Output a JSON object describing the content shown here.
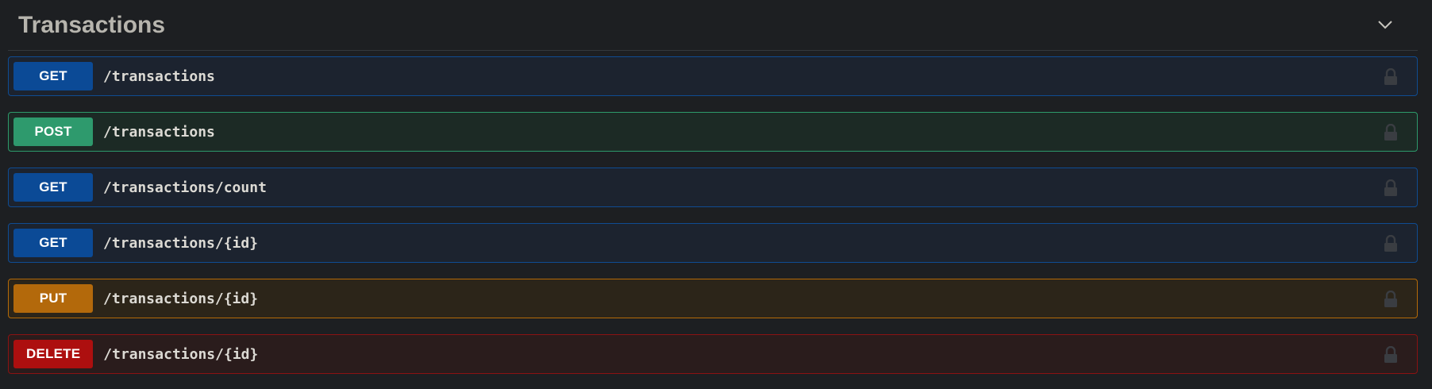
{
  "section": {
    "title": "Transactions",
    "collapse_icon": "chevron-down-icon"
  },
  "operations": [
    {
      "method": "GET",
      "path": "/transactions",
      "method_color": "#0b4a96",
      "lock_icon": "lock-icon"
    },
    {
      "method": "POST",
      "path": "/transactions",
      "method_color": "#2e9a6d",
      "lock_icon": "lock-icon"
    },
    {
      "method": "GET",
      "path": "/transactions/count",
      "method_color": "#0b4a96",
      "lock_icon": "lock-icon"
    },
    {
      "method": "GET",
      "path": "/transactions/{id}",
      "method_color": "#0b4a96",
      "lock_icon": "lock-icon"
    },
    {
      "method": "PUT",
      "path": "/transactions/{id}",
      "method_color": "#b3690b",
      "lock_icon": "lock-icon"
    },
    {
      "method": "DELETE",
      "path": "/transactions/{id}",
      "method_color": "#ad0f0f",
      "lock_icon": "lock-icon"
    }
  ]
}
